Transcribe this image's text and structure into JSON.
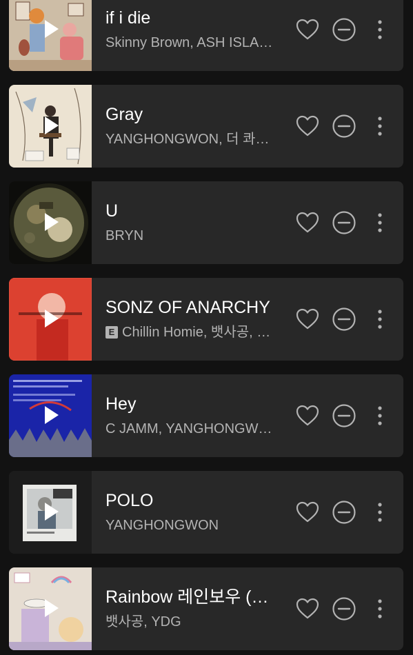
{
  "tracks": [
    {
      "title": "if i die",
      "subtitle": "Skinny Brown, ASH ISLAND",
      "explicit": false,
      "art": "orange-sketch"
    },
    {
      "title": "Gray",
      "subtitle": "YANGHONGWON, 더 콰이엇",
      "explicit": false,
      "art": "beige-room"
    },
    {
      "title": "U",
      "subtitle": "BRYN",
      "explicit": false,
      "art": "dark-circle"
    },
    {
      "title": "SONZ OF ANARCHY",
      "subtitle": "Chillin Homie, 뱃사공, YANGHONGWON",
      "explicit": true,
      "explicit_label": "E",
      "art": "red-portrait"
    },
    {
      "title": "Hey",
      "subtitle": "C JAMM, YANGHONGWON",
      "explicit": false,
      "art": "blue-screen"
    },
    {
      "title": "POLO",
      "subtitle": "YANGHONGWON",
      "explicit": false,
      "art": "polaroid"
    },
    {
      "title": "Rainbow 레인보우 (Feat. YDG)",
      "subtitle": "뱃사공, YDG",
      "explicit": false,
      "art": "pastel-sketch"
    }
  ],
  "colors": {
    "background": "#121212",
    "card": "#282828",
    "title": "#ffffff",
    "subtitle": "#b3b3b3",
    "icon": "#b3b3b3"
  },
  "icons": {
    "play": "play-icon",
    "like": "heart-icon",
    "hide": "hide-minus-circle-icon",
    "more": "more-vertical-icon"
  }
}
